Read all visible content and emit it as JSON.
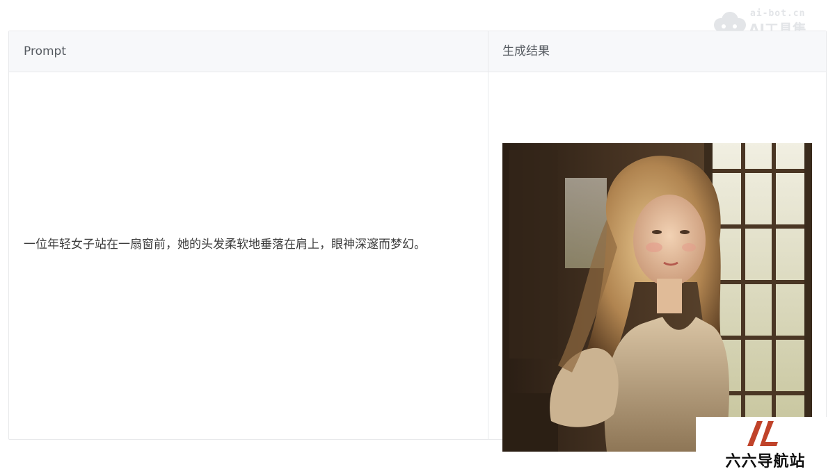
{
  "watermark": {
    "domain": "ai-bot.cn",
    "name": "AI工具集",
    "icon": "cloud-logo-icon"
  },
  "table": {
    "headers": {
      "prompt": "Prompt",
      "result": "生成结果"
    },
    "rows": [
      {
        "prompt": "一位年轻女子站在一扇窗前，她的头发柔软地垂落在肩上，眼神深邃而梦幻。",
        "result_image": "portrait-woman-by-window"
      }
    ]
  },
  "footer_logo": {
    "name": "六六导航站",
    "icon": "double-slash-logo-icon",
    "accent_color": "#c0432a"
  },
  "colors": {
    "header_bg": "#f7f8fa",
    "border": "#e8e9eb",
    "text": "#3d3d3d"
  }
}
